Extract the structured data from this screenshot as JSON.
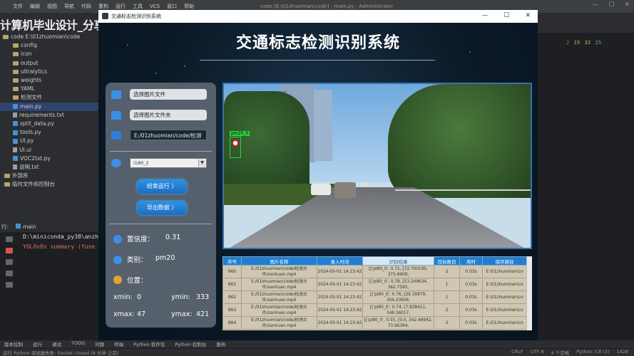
{
  "ide": {
    "menu": [
      "文件",
      "编辑",
      "视图",
      "导航",
      "代码",
      "重构",
      "运行",
      "工具",
      "VCS",
      "窗口",
      "帮助"
    ],
    "window_title": "code [E:\\01zhuomian\\code] - main.py - Administrator",
    "watermark": "计算机毕业设计_分享",
    "watermark_logo": "bilibili",
    "inspections": {
      "errors": "2",
      "warnings": "15",
      "weak": "32",
      "typos": "25"
    }
  },
  "project": {
    "root": "code E:\\01zhuomian\\code",
    "items": [
      {
        "name": "config",
        "type": "folder"
      },
      {
        "name": "icon",
        "type": "folder"
      },
      {
        "name": "output",
        "type": "folder"
      },
      {
        "name": "ultralytics",
        "type": "folder"
      },
      {
        "name": "weights",
        "type": "folder"
      },
      {
        "name": "YAML",
        "type": "folder"
      },
      {
        "name": "检测文件",
        "type": "folder"
      },
      {
        "name": "main.py",
        "type": "py"
      },
      {
        "name": "requirements.txt",
        "type": "txt"
      },
      {
        "name": "split_data.py",
        "type": "py"
      },
      {
        "name": "tools.py",
        "type": "py"
      },
      {
        "name": "UI.py",
        "type": "py"
      },
      {
        "name": "UI.ui",
        "type": "txt"
      },
      {
        "name": "VOC2txt.py",
        "type": "py"
      },
      {
        "name": "说明.txt",
        "type": "txt"
      },
      {
        "name": "外部库",
        "type": "folder"
      },
      {
        "name": "临时文件和控制台",
        "type": "folder"
      }
    ]
  },
  "run": {
    "tab_prefix": "行:",
    "tab": "main",
    "line1": "D:\\miniconda_py38\\anzh",
    "line2": "YOLOv8s summary (fuse"
  },
  "bottom_tabs": [
    "版本控制",
    "运行",
    "调试",
    "TODO",
    "问题",
    "终端",
    "Python 软件包",
    "Python 控制台",
    "服务"
  ],
  "status": {
    "message": "运行 Python 调试器失败: Socket closed (8 分钟 之前)",
    "right": [
      "CRLF",
      "UTF-8",
      "4 个空格",
      "Python 3.8 (3)",
      "1428"
    ]
  },
  "app": {
    "window_title": "交通标志检测识别系统",
    "title": "交通标志检测识别系统",
    "choose_image": "选择图片文件",
    "choose_folder": "选择图片文件夹",
    "path_value": "E:/01zhuomian/code/检测",
    "model_value": "i180_2",
    "stop_button": "结束运行 〉",
    "export_button": "导出数据 〉",
    "confidence_label": "置信度：",
    "confidence_value": "0.31",
    "class_label": "类别：",
    "class_value": "pm20",
    "position_label": "位置：",
    "xmin_label": "xmin:",
    "xmin_value": "0",
    "ymin_label": "ymin:",
    "ymin_value": "333",
    "xmax_label": "xmax:",
    "xmax_value": "47",
    "ymax_label": "ymax:",
    "ymax_value": "421",
    "detection_label": "pm20_0",
    "table": {
      "headers": [
        "序号",
        "图片名称",
        "录入时间",
        "识别结果",
        "目标数目",
        "用时",
        "保存路径"
      ],
      "rows": [
        [
          "960",
          "E:/01zhuomian/code/检测文件/sanhuan.mp4",
          "2024-05-01 14:23:42",
          "[['pl80_0', 0.71, [72.700195, 375.8908,",
          "2",
          "0.03s",
          "E:\\01zhuomian\\co"
        ],
        [
          "961",
          "E:/01zhuomian/code/检测文件/sanhuan.mp4",
          "2024-05-01 14:23:42",
          "[['pl80_0', 0.78, [53.249634, 362.7595,",
          "1",
          "0.03s",
          "E:\\01zhuomian\\co"
        ],
        [
          "962",
          "E:/01zhuomian/code/检测文件/sanhuan.mp4",
          "2024-05-01 14:23:42",
          "[['pl80_0', 0.76, [29.30879, 354.23956,",
          "1",
          "0.03s",
          "E:\\01zhuomian\\co"
        ],
        [
          "963",
          "E:/01zhuomian/code/检测文件/sanhuan.mp4",
          "2024-05-01 14:23:42",
          "[['pl80_0', 0.74, [7.828411, 348.36017,",
          "2",
          "0.03s",
          "E:\\01zhuomian\\co"
        ],
        [
          "964",
          "E:/01zhuomian/code/检测文件/sanhuan.mp4",
          "2024-05-01 14:23:42",
          "[['pl80_0', 0.55, [0.0, 342.46942, 73.96394,",
          "2",
          "0.03s",
          "E:\\01zhuomian\\co"
        ]
      ]
    }
  }
}
